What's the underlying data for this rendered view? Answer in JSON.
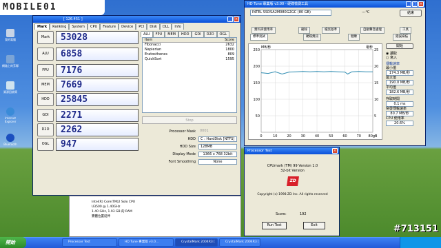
{
  "watermark": "MOBILE01",
  "corner_tag": "#713151",
  "desktop_icons": [
    {
      "label": "我的電腦",
      "color": "#c8d4e6"
    },
    {
      "label": "網路上的芳鄰",
      "color": "#7ba4d6"
    },
    {
      "label": "資源回收筒",
      "color": "#cfe3ef"
    },
    {
      "label": "Internet Explorer",
      "color": "#3a8bd8"
    },
    {
      "label": "Bluetooth",
      "color": "#1b4fbf"
    }
  ],
  "crystalmark": {
    "title": "[ 126.451 ]",
    "tabs": [
      "Mark",
      "Ranking",
      "System",
      "CPU",
      "Feature",
      "Device",
      "PCI",
      "Disk",
      "DLL",
      "Info"
    ],
    "marks": [
      {
        "label": "Mark",
        "value": "53028"
      },
      {
        "label": "ALU",
        "value": "6858"
      },
      {
        "label": "FPU",
        "value": "7176"
      },
      {
        "label": "MEM",
        "value": "7669"
      },
      {
        "label": "HDD",
        "value": "25845"
      },
      {
        "label": "GDI",
        "value": "2271"
      },
      {
        "label": "D2D",
        "value": "2262"
      },
      {
        "label": "OGL",
        "value": "947"
      }
    ],
    "subtabs": [
      "ALU",
      "FPU",
      "MEM",
      "HDD",
      "GDI",
      "D2D",
      "OGL"
    ],
    "table_header": {
      "item": "Item",
      "score": "Score"
    },
    "table_rows": [
      {
        "item": "Fibonacci",
        "score": "2632"
      },
      {
        "item": "Napierian",
        "score": "1800"
      },
      {
        "item": "Eratosthenes",
        "score": "809"
      },
      {
        "item": "QuickSort",
        "score": "1595"
      }
    ],
    "stop_label": "Stop",
    "fields": [
      {
        "label": "Processor Mask",
        "value": "0001"
      },
      {
        "label": "HDD",
        "value": "C : HardDisk [NTFS]"
      },
      {
        "label": "HDD Size",
        "value": "128MB"
      },
      {
        "label": "Display Mode",
        "value": "1366 x 768 32bit"
      },
      {
        "label": "Font Smoothing",
        "value": "None"
      }
    ]
  },
  "sysinfo": {
    "lines": [
      "Intel(R) Core(TM)2 Solo CPU",
      "U3500 @ 1.40GHz",
      "1.40 GHz, 1.93 GB 的 RAM",
      "實體位置延伸"
    ]
  },
  "hdtune": {
    "title": "HD Tune 專業版 v3.00 - 硬碟檢測工具",
    "drive": "INTEL SSDSA2M080G2GC (80 GB)",
    "temp": "---°C",
    "exit_label": "結束",
    "tabs_row1": [
      "資料夾使用率",
      "刪除",
      "檔案基準",
      "自動聲音處理",
      "工具"
    ],
    "tabs_row2": [
      "標準測試",
      "硬碟資訊",
      "健康",
      "錯誤掃描"
    ],
    "y_unit": "MB/秒",
    "y_unit_right": "毫秒",
    "start_label": "開始",
    "read_label": "讀取",
    "write_label": "寫入",
    "transfer_label": "傳輸速率",
    "min_label": "最小值",
    "min_value": "174.3 MB/秒",
    "max_label": "最大值",
    "max_value": "190.0 MB/秒",
    "avg_label": "平均值",
    "avg_value": "182.6 MB/秒",
    "access_label": "存取時間",
    "access_value": "0.1 ms",
    "burst_label": "突發傳輸速率",
    "burst_value": "80.7 MB/秒",
    "cpu_label": "CPU 使用率",
    "cpu_value": "20.6%"
  },
  "hd_chart": {
    "chart_data": {
      "type": "line",
      "x": [
        0,
        5,
        10,
        15,
        20,
        25,
        30,
        35,
        40,
        45,
        50,
        55,
        60,
        62,
        65,
        70,
        75,
        80
      ],
      "series": [
        {
          "values": [
            180,
            178,
            183,
            176,
            182,
            183,
            184,
            183,
            184,
            183,
            184,
            183,
            182,
            176,
            183,
            184,
            183,
            183
          ]
        }
      ],
      "y_ticks": [
        "250",
        "200",
        "150",
        "100",
        "50"
      ],
      "x_ticks": [
        "0",
        "10",
        "20",
        "30",
        "40",
        "50",
        "60",
        "70",
        "80gB"
      ],
      "y2_ticks": [
        "25",
        "20",
        "15",
        "10",
        "5"
      ],
      "ylim": [
        0,
        250
      ],
      "xlim": [
        0,
        80
      ]
    }
  },
  "processor_test": {
    "title": "Processor Test",
    "line1": "CPUmark (TM) 99 Version 1.0",
    "line2": "32-bit Version",
    "badge": "ZD",
    "copyright": "Copyright (c) 1998 ZD Inc. All rights reserved",
    "score_label": "Score:",
    "score_value": "192",
    "run_label": "Run Test",
    "exit_label": "Exit"
  },
  "taskbar": {
    "start_label": "開始",
    "buttons": [
      "Processor Test",
      "HD Tune 專業版 v3.0...",
      "CrystalMark 2004R3 [",
      "CrystalMark 2004R3 ["
    ]
  }
}
